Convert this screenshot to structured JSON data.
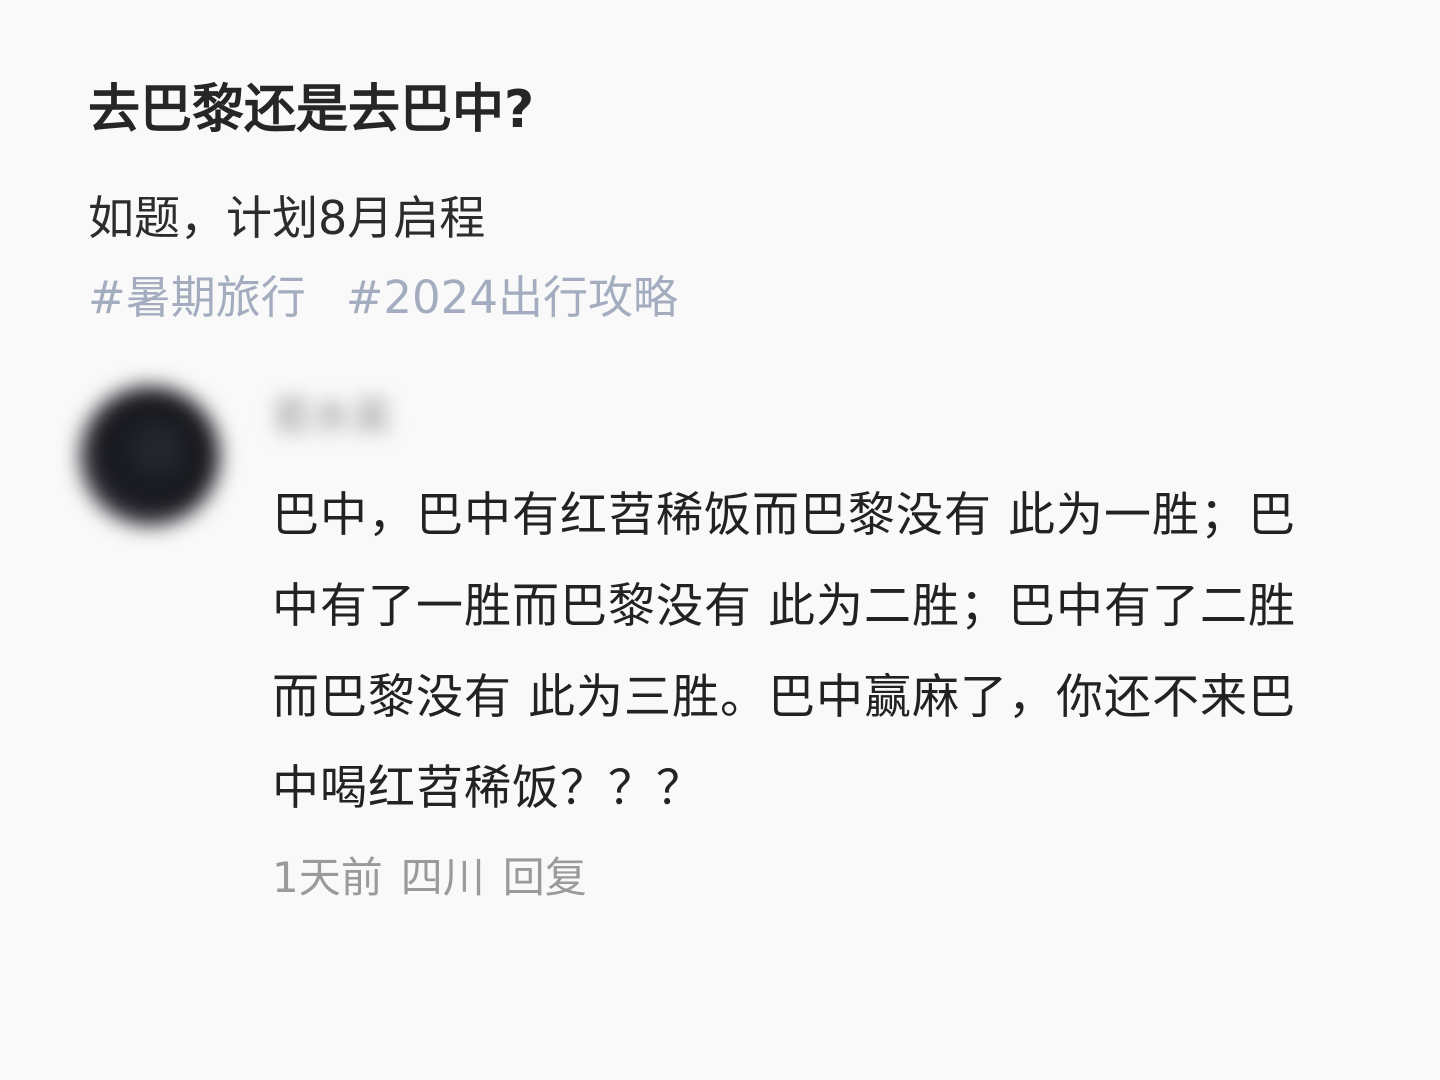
{
  "post": {
    "title": "去巴黎还是去巴中?",
    "body": "如题，计划8月启程",
    "tags": [
      "#暑期旅行",
      "#2024出行攻略"
    ]
  },
  "comment": {
    "username": "若水吴",
    "text": "巴中，巴中有红苕稀饭而巴黎没有 此为一胜；巴中有了一胜而巴黎没有 此为二胜；巴中有了二胜而巴黎没有 此为三胜。巴中赢麻了，你还不来巴中喝红苕稀饭？？？",
    "time": "1天前",
    "location": "四川",
    "reply_label": "回复"
  },
  "colors": {
    "background": "#f9f9f9",
    "tag": "#a3adbf",
    "meta": "#9a9a9a"
  }
}
